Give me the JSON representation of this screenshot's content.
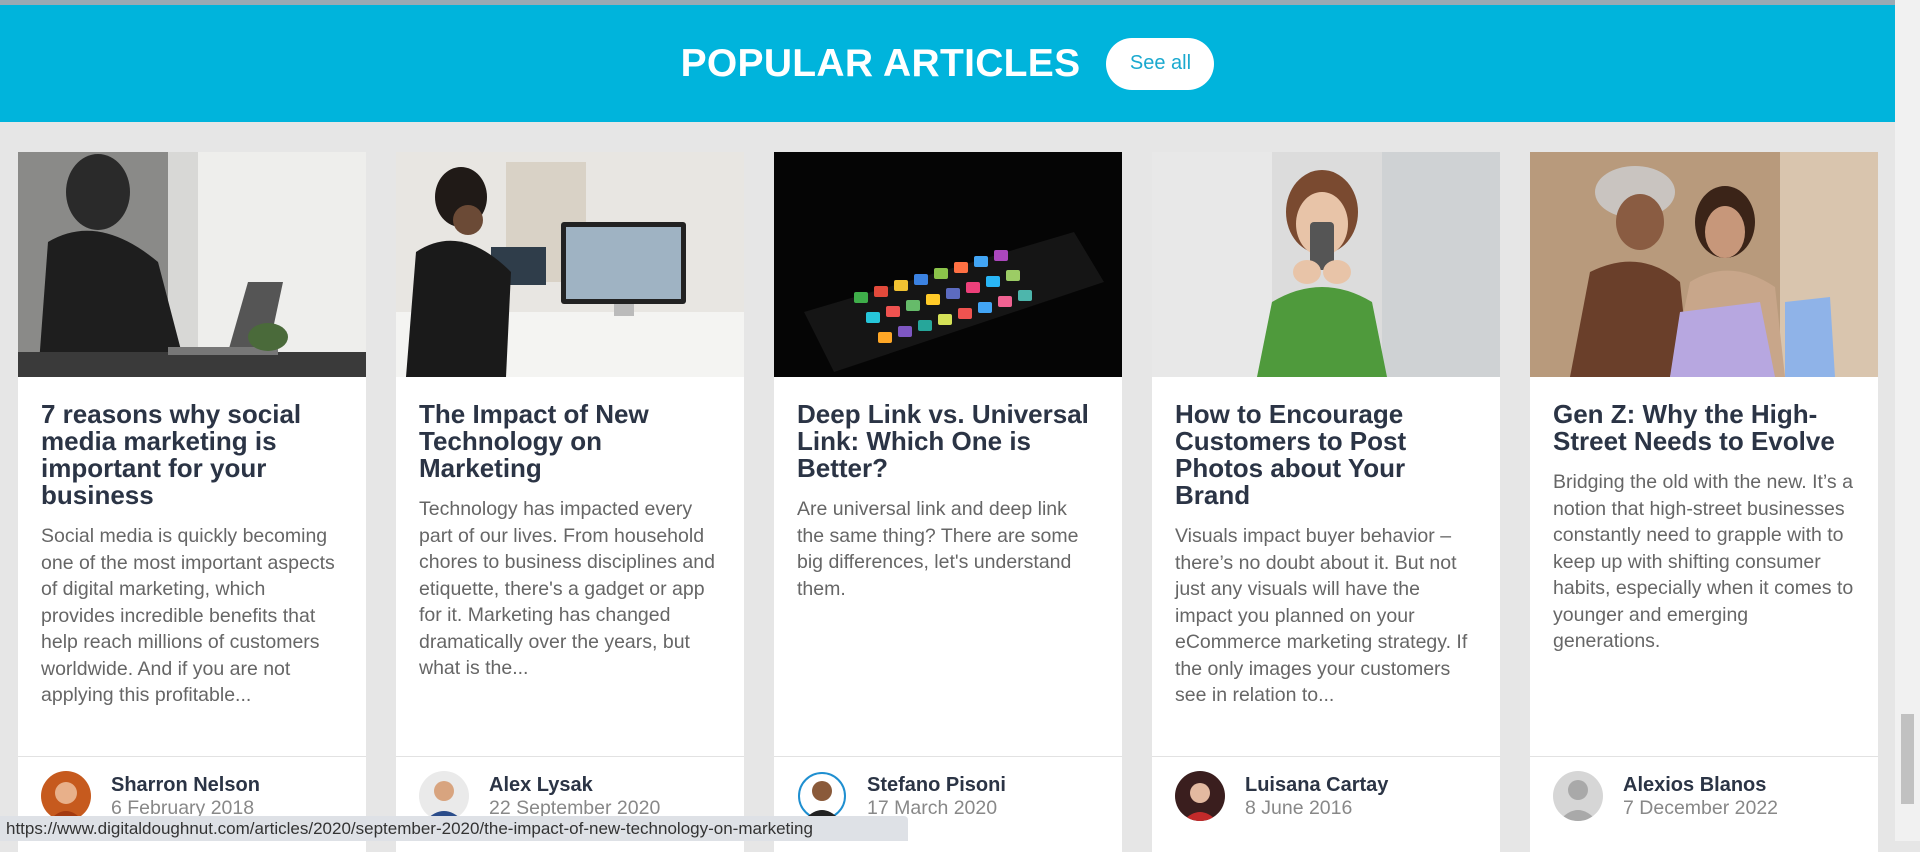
{
  "banner": {
    "title": "POPULAR ARTICLES",
    "see_all_label": "See all",
    "background_color": "#00b4dc"
  },
  "articles": [
    {
      "title": "7 reasons why social media marketing is important for your business",
      "excerpt": "Social media is quickly becoming one of the most important aspects of digital marketing, which provides incredible benefits that help reach millions of customers worldwide. And if you are not applying this profitable...",
      "author": "Sharron Nelson",
      "date": "6 February 2018"
    },
    {
      "title": "The Impact of New Technology on Marketing",
      "excerpt": "Technology has impacted every part of our lives. From household chores to business disciplines and etiquette, there's a gadget or app for it. Marketing has changed dramatically over the years, but what is the...",
      "author": "Alex Lysak",
      "date": "22 September 2020"
    },
    {
      "title": "Deep Link vs. Universal Link: Which One is Better?",
      "excerpt": "Are universal link and deep link the same thing? There are some big differences, let's understand them.",
      "author": "Stefano Pisoni",
      "date": "17 March 2020"
    },
    {
      "title": "How to Encourage Customers to Post Photos about Your Brand",
      "excerpt": "Visuals impact buyer behavior – there’s no doubt about it. But not just any visuals will have the impact you planned on your eCommerce marketing strategy. If the only images your customers see in relation to...",
      "author": "Luisana Cartay",
      "date": "8 June 2016"
    },
    {
      "title": "Gen Z: Why the High-Street Needs to Evolve",
      "excerpt": "Bridging the old with the new. It’s a notion that high-street businesses constantly need to grapple with to keep up with shifting consumer habits, especially when it comes to younger and emerging generations.",
      "author": "Alexios Blanos",
      "date": "7 December 2022"
    }
  ],
  "status_bar": {
    "url": "https://www.digitaldoughnut.com/articles/2020/september-2020/the-impact-of-new-technology-on-marketing"
  }
}
